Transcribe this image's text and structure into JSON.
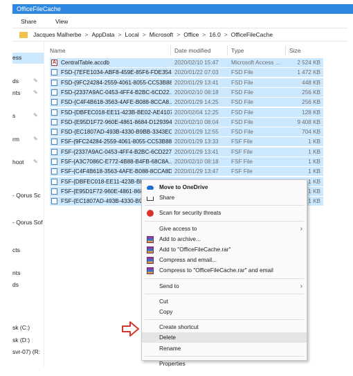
{
  "window": {
    "title": "OfficeFileCache"
  },
  "ribbon": {
    "tabs": [
      "Share",
      "View"
    ]
  },
  "address": {
    "crumbs": [
      "Jacques Malherbe",
      "AppData",
      "Local",
      "Microsoft",
      "Office",
      "16.0",
      "OfficeFileCache"
    ],
    "separator": ">"
  },
  "nav": {
    "items": [
      "ess",
      "ds",
      "nts",
      "s",
      "rm",
      "hoot",
      "- Qorus Sc",
      "- Qorus Sof",
      "cts",
      "nts",
      "ds",
      "sk (C:)",
      "sk (D:)",
      "svr-07) (R:"
    ]
  },
  "columns": {
    "name": "Name",
    "date": "Date modified",
    "type": "Type",
    "size": "Size"
  },
  "files": [
    {
      "name": "CentralTable.accdb",
      "date": "2020/02/10 15:47",
      "type": "Microsoft Access ...",
      "size": "2 524 KB",
      "icon": "access-icon"
    },
    {
      "name": "FSD-{7EFE1034-ABF8-459E-85F6-FDE3548...",
      "date": "2020/01/22 07:03",
      "type": "FSD File",
      "size": "1 472 KB",
      "icon": "file-icon"
    },
    {
      "name": "FSD-{9FC24284-2559-4061-8055-CC53B88...",
      "date": "2020/01/29 13:41",
      "type": "FSD File",
      "size": "448 KB",
      "icon": "file-icon"
    },
    {
      "name": "FSD-{2337A9AC-0453-4FF4-B2BC-6CD22...",
      "date": "2020/02/10 08:18",
      "type": "FSD File",
      "size": "256 KB",
      "icon": "file-icon"
    },
    {
      "name": "FSD-{C4F4B618-3563-4AFE-B088-8CCA8...",
      "date": "2020/01/29 14:25",
      "type": "FSD File",
      "size": "256 KB",
      "icon": "file-icon"
    },
    {
      "name": "FSD-{DBFEC018-EE11-423B-BE02-AE4107...",
      "date": "2020/02/04 12:25",
      "type": "FSD File",
      "size": "128 KB",
      "icon": "file-icon"
    },
    {
      "name": "FSD-{E95D1F72-960E-4861-8684-D129394...",
      "date": "2020/02/10 08:04",
      "type": "FSD File",
      "size": "9 408 KB",
      "icon": "file-icon"
    },
    {
      "name": "FSD-{EC1807AD-493B-4330-B9BB-3343EC...",
      "date": "2020/01/29 12:55",
      "type": "FSD File",
      "size": "704 KB",
      "icon": "file-icon"
    },
    {
      "name": "FSF-{9FC24284-2559-4061-8055-CC53B88...",
      "date": "2020/01/29 13:33",
      "type": "FSF File",
      "size": "1 KB",
      "icon": "file-icon"
    },
    {
      "name": "FSF-{2337A9AC-0453-4FF4-B2BC-6CD227...",
      "date": "2020/01/29 13:41",
      "type": "FSF File",
      "size": "1 KB",
      "icon": "file-icon"
    },
    {
      "name": "FSF-{A3C7086C-E772-4B88-B4FB-68C8A...",
      "date": "2020/02/10 08:18",
      "type": "FSF File",
      "size": "1 KB",
      "icon": "file-icon"
    },
    {
      "name": "FSF-{C4F4B618-3563-4AFE-B088-8CCA8D...",
      "date": "2020/01/29 13:47",
      "type": "FSF File",
      "size": "1 KB",
      "icon": "file-icon"
    },
    {
      "name": "FSF-{DBFEC018-EE11-423B-BE02-",
      "date": "",
      "type": "",
      "size": "1 KB",
      "icon": "file-icon"
    },
    {
      "name": "FSF-{E95D1F72-960E-4861-8684-",
      "date": "",
      "type": "",
      "size": "1 KB",
      "icon": "file-icon"
    },
    {
      "name": "FSF-{EC1807AD-493B-4330-B9BB-",
      "date": "",
      "type": "",
      "size": "1 KB",
      "icon": "file-icon"
    }
  ],
  "context_menu": {
    "items": [
      {
        "label": "Move to OneDrive",
        "icon": "onedrive-icon",
        "bold": true,
        "arrow": false
      },
      {
        "label": "Share",
        "icon": "share-icon",
        "bold": false,
        "arrow": false
      },
      {
        "sep": true
      },
      {
        "label": "Scan for security threats",
        "icon": "shield-icon",
        "bold": false,
        "arrow": false
      },
      {
        "sep": true
      },
      {
        "label": "Give access to",
        "icon": "",
        "bold": false,
        "arrow": true
      },
      {
        "label": "Add to archive...",
        "icon": "winrar-icon",
        "bold": false,
        "arrow": false
      },
      {
        "label": "Add to \"OfficeFileCache.rar\"",
        "icon": "winrar-icon",
        "bold": false,
        "arrow": false
      },
      {
        "label": "Compress and email...",
        "icon": "winrar-icon",
        "bold": false,
        "arrow": false
      },
      {
        "label": "Compress to \"OfficeFileCache.rar\" and email",
        "icon": "winrar-icon",
        "bold": false,
        "arrow": false
      },
      {
        "sep": true
      },
      {
        "label": "Send to",
        "icon": "",
        "bold": false,
        "arrow": true
      },
      {
        "sep": true
      },
      {
        "label": "Cut",
        "icon": "",
        "bold": false,
        "arrow": false
      },
      {
        "label": "Copy",
        "icon": "",
        "bold": false,
        "arrow": false
      },
      {
        "sep": true
      },
      {
        "label": "Create shortcut",
        "icon": "",
        "bold": false,
        "arrow": false
      },
      {
        "label": "Delete",
        "icon": "",
        "bold": false,
        "arrow": false,
        "highlight": true
      },
      {
        "label": "Rename",
        "icon": "",
        "bold": false,
        "arrow": false
      },
      {
        "sep": true
      },
      {
        "label": "Properties",
        "icon": "",
        "bold": false,
        "arrow": false
      }
    ],
    "submenu_arrow": "›"
  },
  "annotation": {
    "icon": "red-arrow-icon",
    "color": "#d9342b"
  },
  "colors": {
    "titlebar": "#2f89e0",
    "selection": "#cce8ff",
    "menu_highlight": "#e5e5e5"
  }
}
